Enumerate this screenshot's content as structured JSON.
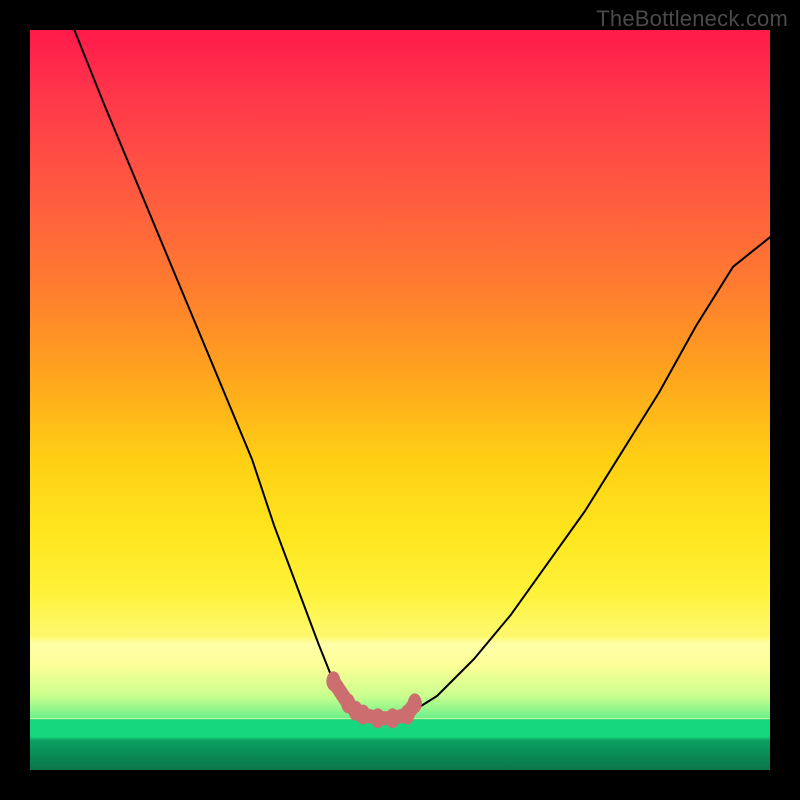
{
  "watermark": "TheBottleneck.com",
  "chart_data": {
    "type": "line",
    "title": "",
    "xlabel": "",
    "ylabel": "",
    "xlim": [
      0,
      100
    ],
    "ylim": [
      0,
      100
    ],
    "grid": false,
    "legend": false,
    "series": [
      {
        "name": "bottleneck-curve",
        "x": [
          6,
          10,
          15,
          20,
          25,
          30,
          33,
          36,
          39,
          41,
          43,
          45,
          47,
          49,
          51,
          55,
          60,
          65,
          70,
          75,
          80,
          85,
          90,
          95,
          100
        ],
        "values": [
          100,
          90,
          78,
          66,
          54,
          42,
          33,
          25,
          17,
          12,
          9,
          7.5,
          7,
          7,
          7.5,
          10,
          15,
          21,
          28,
          35,
          43,
          51,
          60,
          68,
          72
        ]
      }
    ],
    "markers": {
      "name": "minimum-region-markers",
      "color": "#cc6e70",
      "x": [
        41,
        43,
        44,
        45,
        47,
        49,
        51,
        52
      ],
      "values": [
        12,
        9,
        8,
        7.5,
        7,
        7,
        7.5,
        9
      ]
    },
    "gradient_stops": [
      {
        "pos": 0,
        "color": "#ff1a4a"
      },
      {
        "pos": 34,
        "color": "#ff7a30"
      },
      {
        "pos": 58,
        "color": "#ffcf14"
      },
      {
        "pos": 82,
        "color": "#fff970"
      },
      {
        "pos": 86,
        "color": "#ffffa8"
      },
      {
        "pos": 93,
        "color": "#17d77e"
      },
      {
        "pos": 100,
        "color": "#0a754a"
      }
    ]
  }
}
